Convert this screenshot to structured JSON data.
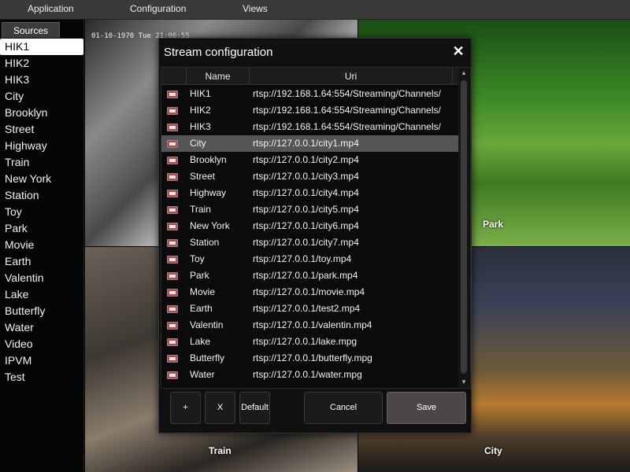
{
  "menu": {
    "items": [
      "Application",
      "Configuration",
      "Views"
    ]
  },
  "sidebar": {
    "header": "Sources",
    "items": [
      "HIK1",
      "HIK2",
      "HIK3",
      "City",
      "Brooklyn",
      "Street",
      "Highway",
      "Train",
      "New York",
      "Station",
      "Toy",
      "Park",
      "Movie",
      "Earth",
      "Valentin",
      "Lake",
      "Butterfly",
      "Water",
      "Video",
      "IPVM",
      "Test"
    ],
    "selected": "HIK1"
  },
  "tiles": {
    "top_left_timestamp": "01-10-1970 Tue 21:06:55",
    "top_right_label": "Park",
    "bottom_left_label": "Train",
    "bottom_right_label": "City"
  },
  "dialog": {
    "title": "Stream configuration",
    "close_glyph": "✕",
    "columns": {
      "name": "Name",
      "uri": "Uri"
    },
    "selected_row": "City",
    "rows": [
      {
        "name": "HIK1",
        "uri": "rtsp://192.168.1.64:554/Streaming/Channels/"
      },
      {
        "name": "HIK2",
        "uri": "rtsp://192.168.1.64:554/Streaming/Channels/"
      },
      {
        "name": "HIK3",
        "uri": "rtsp://192.168.1.64:554/Streaming/Channels/"
      },
      {
        "name": "City",
        "uri": "rtsp://127.0.0.1/city1.mp4"
      },
      {
        "name": "Brooklyn",
        "uri": "rtsp://127.0.0.1/city2.mp4"
      },
      {
        "name": "Street",
        "uri": "rtsp://127.0.0.1/city3.mp4"
      },
      {
        "name": "Highway",
        "uri": "rtsp://127.0.0.1/city4.mp4"
      },
      {
        "name": "Train",
        "uri": "rtsp://127.0.0.1/city5.mp4"
      },
      {
        "name": "New York",
        "uri": "rtsp://127.0.0.1/city6.mp4"
      },
      {
        "name": "Station",
        "uri": "rtsp://127.0.0.1/city7.mp4"
      },
      {
        "name": "Toy",
        "uri": "rtsp://127.0.0.1/toy.mp4"
      },
      {
        "name": "Park",
        "uri": "rtsp://127.0.0.1/park.mp4"
      },
      {
        "name": "Movie",
        "uri": "rtsp://127.0.0.1/movie.mp4"
      },
      {
        "name": "Earth",
        "uri": "rtsp://127.0.0.1/test2.mp4"
      },
      {
        "name": "Valentin",
        "uri": "rtsp://127.0.0.1/valentin.mp4"
      },
      {
        "name": "Lake",
        "uri": "rtsp://127.0.0.1/lake.mpg"
      },
      {
        "name": "Butterfly",
        "uri": "rtsp://127.0.0.1/butterfly.mpg"
      },
      {
        "name": "Water",
        "uri": "rtsp://127.0.0.1/water.mpg"
      }
    ],
    "buttons": {
      "add": "+",
      "remove": "X",
      "default": "Default",
      "cancel": "Cancel",
      "save": "Save"
    }
  }
}
